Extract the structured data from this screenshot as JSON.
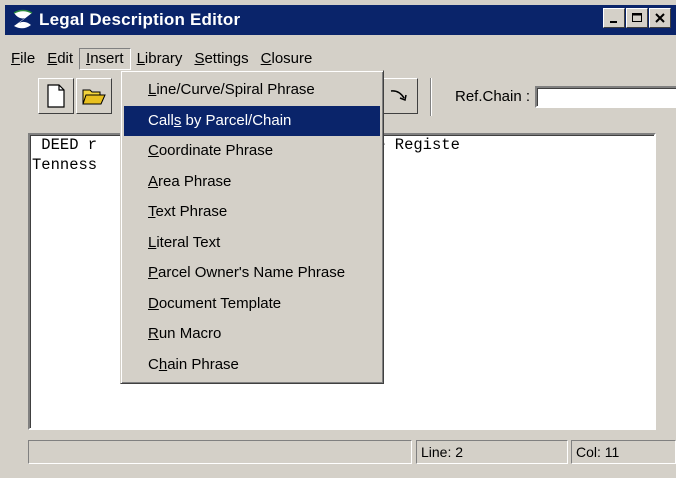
{
  "window": {
    "title": "Legal Description Editor",
    "icon": "app-logo-icon"
  },
  "menubar": {
    "items": [
      {
        "pre": "",
        "key": "F",
        "post": "ile"
      },
      {
        "pre": "",
        "key": "E",
        "post": "dit"
      },
      {
        "pre": "",
        "key": "I",
        "post": "nsert"
      },
      {
        "pre": "",
        "key": "L",
        "post": "ibrary"
      },
      {
        "pre": "",
        "key": "S",
        "post": "ettings"
      },
      {
        "pre": "",
        "key": "C",
        "post": "losure"
      }
    ]
  },
  "toolbar": {
    "refchain_label": "Ref.Chain :",
    "refchain_value": ""
  },
  "insert_menu": {
    "items": [
      {
        "pre": "",
        "key": "L",
        "post": "ine/Curve/Spiral Phrase"
      },
      {
        "pre": "Call",
        "key": "s",
        "post": " by Parcel/Chain"
      },
      {
        "pre": "",
        "key": "C",
        "post": "oordinate Phrase"
      },
      {
        "pre": "",
        "key": "A",
        "post": "rea Phrase"
      },
      {
        "pre": "",
        "key": "T",
        "post": "ext Phrase"
      },
      {
        "pre": "",
        "key": "L",
        "post": "iteral Text"
      },
      {
        "pre": "",
        "key": "P",
        "post": "arcel Owner's Name Phrase"
      },
      {
        "pre": "",
        "key": "D",
        "post": "ocument Template"
      },
      {
        "pre": "",
        "key": "R",
        "post": "un Macro"
      },
      {
        "pre": "C",
        "key": "h",
        "post": "ain Phrase"
      }
    ],
    "highlighted_index": 1
  },
  "editor": {
    "line1_a": " DEED r",
    "line1_b": "                 ge 652, in the Registe",
    "line2": "Tenness"
  },
  "statusbar": {
    "message": "",
    "line": "Line: 2",
    "col": "Col: 11"
  },
  "colors": {
    "titlebar": "#0a246a",
    "highlight": "#0a246a",
    "face": "#d4d0c8"
  }
}
